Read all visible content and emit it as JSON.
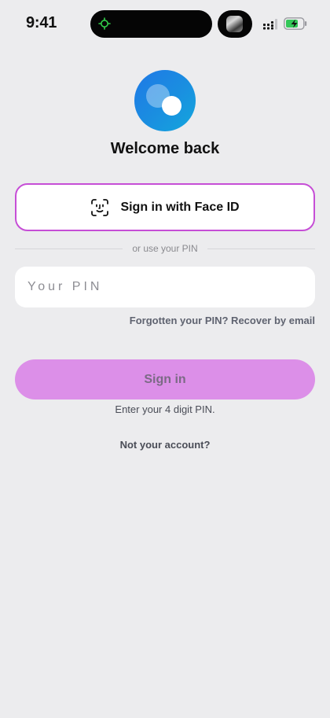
{
  "status_bar": {
    "time": "9:41"
  },
  "colors": {
    "background": "#ececee",
    "accent_border": "#c64ed6",
    "sign_in_button": "#dc8fe8",
    "sign_in_text": "#7b6a85",
    "logo_blue": "#1a8fe0"
  },
  "icons": {
    "island_indicator": "green-activity-icon",
    "media_thumbnail": "album-art-icon",
    "signal": "cellular-signal-icon",
    "battery": "battery-charging-icon",
    "logo": "app-logo-icon",
    "face_id": "face-id-icon"
  },
  "header": {
    "title": "Welcome back"
  },
  "face_id_button": {
    "label": "Sign in with Face ID"
  },
  "divider": {
    "text": "or use your PIN"
  },
  "pin": {
    "placeholder": "Your PIN",
    "value": ""
  },
  "forgot": {
    "label": "Forgotten your PIN? Recover by email"
  },
  "sign_in": {
    "label": "Sign in"
  },
  "hint": {
    "text": "Enter your 4 digit PIN."
  },
  "account": {
    "label": "Not your account?"
  }
}
